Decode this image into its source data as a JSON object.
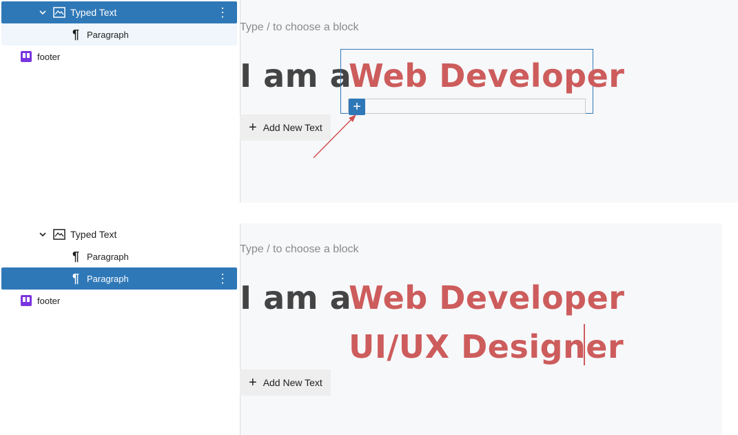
{
  "top_panel": {
    "list_view": {
      "typed_text_label": "Typed Text",
      "paragraph_label": "Paragraph",
      "footer_label": "footer"
    },
    "canvas": {
      "hint": "Type / to choose a block",
      "prefix": "I am a",
      "typed_items": [
        "Web Developer"
      ],
      "add_button_label": "Add New Text",
      "add_button_icon": "+"
    }
  },
  "bottom_panel": {
    "list_view": {
      "typed_text_label": "Typed Text",
      "paragraph_1_label": "Paragraph",
      "paragraph_2_label": "Paragraph",
      "footer_label": "footer"
    },
    "canvas": {
      "hint": "Type / to choose a block",
      "prefix": "I am a",
      "typed_items": [
        "Web Developer",
        "UI/UX Designer"
      ],
      "add_button_label": "Add New Text",
      "add_button_icon": "+"
    }
  },
  "colors": {
    "selected_row": "#2f78b7",
    "typed_text": "#cd5c5c",
    "annotation_arrow": "#d05050",
    "footer_icon": "#7a34e0"
  },
  "icons": [
    "chevron-down-icon",
    "image-icon",
    "paragraph-icon",
    "footer-icon",
    "more-options-icon",
    "plus-icon"
  ]
}
